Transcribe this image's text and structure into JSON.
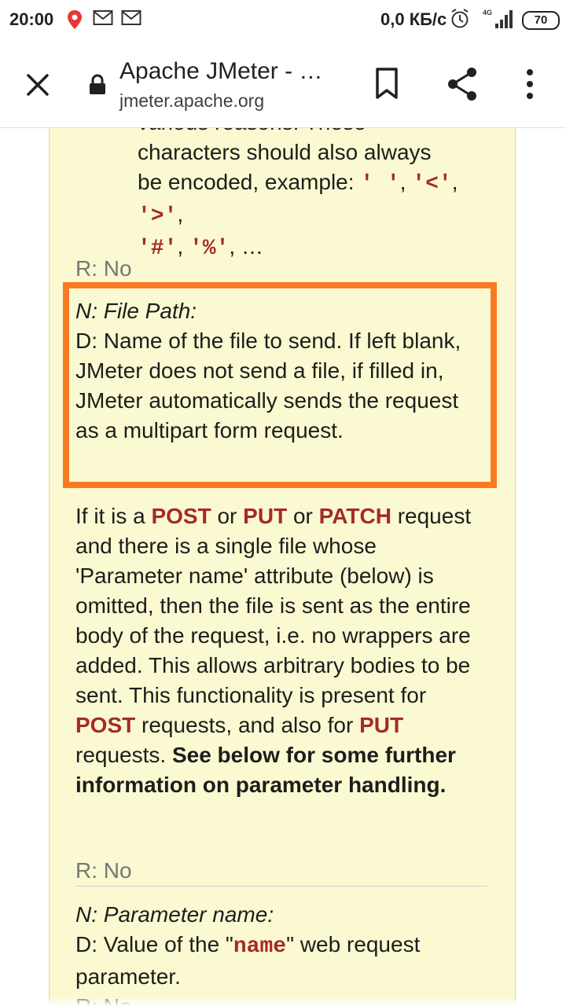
{
  "status_bar": {
    "time": "20:00",
    "network_speed": "0,0 КБ/с",
    "signal_label": "4G",
    "battery": "70"
  },
  "toolbar": {
    "title": "Apache JMeter - …",
    "url": "jmeter.apache.org"
  },
  "content": {
    "cont_line1": "various reasons. These",
    "cont_line2": "characters should also always",
    "cont_line3_prefix": "be encoded, example: ",
    "cont_examples_a": [
      "' '",
      "'<'",
      "'>'"
    ],
    "cont_examples_b": [
      "'#'",
      "'%'"
    ],
    "cont_ellipsis": "…",
    "r1": "R: No",
    "file_path": {
      "name": "N: File Path:",
      "desc": "D: Name of the file to send. If left blank, JMeter does not send a file, if filled in, JMeter automatically sends the request as a multipart form request."
    },
    "para": {
      "p1": "If it is a ",
      "post": "POST",
      "or1": " or ",
      "put": "PUT",
      "or2": " or ",
      "patch": "PATCH",
      "p2": " request and there is a single file whose 'Parameter name' attribute (below) is omitted, then the file is sent as the entire body of the request, i.e. no wrappers are added. This allows arbitrary bodies to be sent. This functionality is present for ",
      "post2": "POST",
      "p3": " requests, and also for ",
      "put2": "PUT",
      "p4": " requests.",
      "bold": "See below for some further information on parameter handling."
    },
    "r2": "R: No",
    "param": {
      "name": "N: Parameter name:",
      "desc_prefix": "D: Value of the \"",
      "desc_code": "name",
      "desc_suffix": "\" web request parameter.",
      "r3": "R: No"
    }
  }
}
